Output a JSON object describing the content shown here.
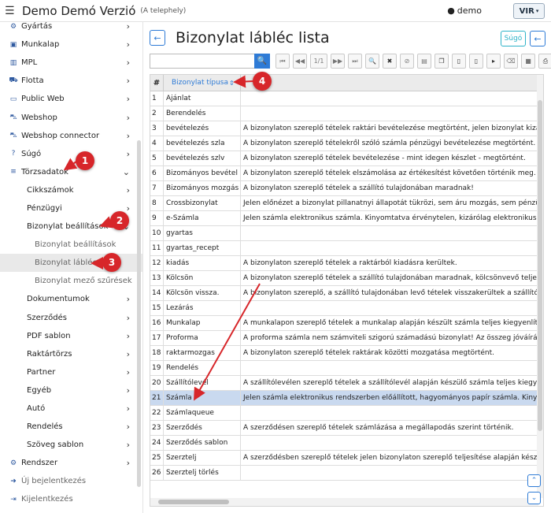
{
  "header": {
    "app_title": "Demo Demó Verzió",
    "site": "(A telephely)",
    "user": "demo",
    "logo_text": "VIR"
  },
  "sidebar": {
    "items": [
      {
        "label": "Gyártás",
        "icon": "factory-icon",
        "level": 1,
        "chevron": true
      },
      {
        "label": "Munkalap",
        "icon": "briefcase-icon",
        "level": 1,
        "chevron": true
      },
      {
        "label": "MPL",
        "icon": "chart-icon",
        "level": 1,
        "chevron": true
      },
      {
        "label": "Flotta",
        "icon": "car-icon",
        "level": 1,
        "chevron": true
      },
      {
        "label": "Public Web",
        "icon": "monitor-icon",
        "level": 1,
        "chevron": true
      },
      {
        "label": "Webshop",
        "icon": "cart-icon",
        "level": 1,
        "chevron": true
      },
      {
        "label": "Webshop connector",
        "icon": "cart-icon",
        "level": 1,
        "chevron": true
      },
      {
        "label": "Súgó",
        "icon": "question-icon",
        "level": 1,
        "chevron": true
      },
      {
        "label": "Törzsadatok",
        "icon": "database-icon",
        "level": 1,
        "chevron": "down"
      },
      {
        "label": "Cikkszámok",
        "level": 2,
        "chevron": true
      },
      {
        "label": "Pénzügyi",
        "level": 2,
        "chevron": true
      },
      {
        "label": "Bizonylat beállítások",
        "level": 2,
        "chevron": "down"
      },
      {
        "label": "Bizonylat beállítások",
        "level": 3
      },
      {
        "label": "Bizonylat lábléc",
        "level": 3,
        "active": true
      },
      {
        "label": "Bizonylat mező szűrések",
        "level": 3
      },
      {
        "label": "Dokumentumok",
        "level": 2,
        "chevron": true
      },
      {
        "label": "Szerződés",
        "level": 2,
        "chevron": true
      },
      {
        "label": "PDF sablon",
        "level": 2,
        "chevron": true
      },
      {
        "label": "Raktártörzs",
        "level": 2,
        "chevron": true
      },
      {
        "label": "Partner",
        "level": 2,
        "chevron": true
      },
      {
        "label": "Egyéb",
        "level": 2,
        "chevron": true
      },
      {
        "label": "Autó",
        "level": 2,
        "chevron": true
      },
      {
        "label": "Rendelés",
        "level": 2,
        "chevron": true
      },
      {
        "label": "Szöveg sablon",
        "level": 2,
        "chevron": true
      },
      {
        "label": "Rendszer",
        "icon": "gears-icon",
        "level": 1,
        "chevron": true
      },
      {
        "label": "Új bejelentkezés",
        "icon": "login-icon",
        "level": 1,
        "faded": true
      },
      {
        "label": "Kijelentkezés",
        "icon": "logout-icon",
        "level": 1,
        "faded": true
      }
    ]
  },
  "page": {
    "title": "Bizonylat lábléc lista",
    "help_label": "Súgó",
    "pager_text": "1/1",
    "search_placeholder": ""
  },
  "table": {
    "hash_header": "#",
    "col_header": "Bizonylat típusa",
    "selected_row": 21,
    "rows": [
      {
        "n": "1",
        "type": "Ajánlat",
        "text": ""
      },
      {
        "n": "2",
        "type": "Berendelés",
        "text": ""
      },
      {
        "n": "3",
        "type": "bevételezés",
        "text": "A bizonylaton szereplő tételek raktári bevételezése megtörtént, jelen bizonylat kizáró"
      },
      {
        "n": "4",
        "type": "bevételezés szla",
        "text": "A bizonylaton szereplő tételekről szóló számla pénzügyi bevételezése megtörtént."
      },
      {
        "n": "5",
        "type": "bevételezés szlv",
        "text": "A bizonylaton szereplő tételek bevételezése - mint idegen készlet - megtörtént."
      },
      {
        "n": "6",
        "type": "Bizományos bevétel",
        "text": "A bizonylaton szereplő tételek elszámolása az értékesítést követően történik meg."
      },
      {
        "n": "7",
        "type": "Bizományos mozgás",
        "text": "A bizonylaton szereplő tételek a szállító tulajdonában maradnak!"
      },
      {
        "n": "8",
        "type": "Crossbizonylat",
        "text": "Jelen előnézet a bizonylat pillanatnyi állapotát tükrözi, sem áru mozgás, sem pénzüg"
      },
      {
        "n": "9",
        "type": "e-Számla",
        "text": "Jelen számla elektronikus számla. Kinyomtatva érvénytelen, kizárólag elektronikusan"
      },
      {
        "n": "10",
        "type": "gyartas",
        "text": ""
      },
      {
        "n": "11",
        "type": "gyartas_recept",
        "text": ""
      },
      {
        "n": "12",
        "type": "kiadás",
        "text": "A bizonylaton szereplő tételek a raktárból kiadásra kerültek."
      },
      {
        "n": "13",
        "type": "Kölcsön",
        "text": "A bizonylaton szereplő tételek a szállító tulajdonában maradnak, kölcsönvevő teljes fe"
      },
      {
        "n": "14",
        "type": "Kölcsön vissza.",
        "text": "A bizonylaton szereplő, a szállító tulajdonában levő tételek visszakerültek a szállító ral"
      },
      {
        "n": "15",
        "type": "Lezárás",
        "text": ""
      },
      {
        "n": "16",
        "type": "Munkalap",
        "text": "A munkalapon szereplő tételek a munkalap alapján készült számla teljes kiegyenlítés"
      },
      {
        "n": "17",
        "type": "Proforma",
        "text": "A proforma számla nem számviteli szigorú számadású bizonylat! Az összeg jóváírásá"
      },
      {
        "n": "18",
        "type": "raktarmozgas",
        "text": "A bizonylaton szereplő tételek raktárak közötti mozgatása megtörtént."
      },
      {
        "n": "19",
        "type": "Rendelés",
        "text": ""
      },
      {
        "n": "20",
        "type": "Szállítólevél",
        "text": "A szállítólevélen szereplő tételek a szállítólevél alapján készülő számla teljes kiegyenli"
      },
      {
        "n": "21",
        "type": "Számla",
        "text": "Jelen számla elektronikus rendszerben előállított, hagyományos papír számla. Kinyor"
      },
      {
        "n": "22",
        "type": "Számlaqueue",
        "text": ""
      },
      {
        "n": "23",
        "type": "Szerződés",
        "text": "A szerződésen szereplő tételek számlázása a megállapodás szerint történik."
      },
      {
        "n": "24",
        "type": "Szerződés sablon",
        "text": ""
      },
      {
        "n": "25",
        "type": "Szerztelj",
        "text": "A szerződésben szereplő tételek jelen bizonylaton szereplő teljesítése alapján készül c"
      },
      {
        "n": "26",
        "type": "Szerztelj törlés",
        "text": ""
      }
    ]
  },
  "annotations": [
    "1",
    "2",
    "3",
    "4"
  ],
  "colors": {
    "accent": "#2e7bd6",
    "badge": "#d7262a",
    "selected_row": "#c9d9ef"
  }
}
